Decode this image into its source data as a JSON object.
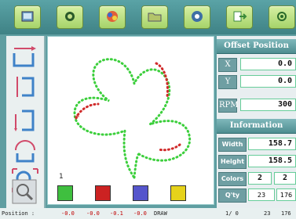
{
  "toolbar": {
    "buttons": [
      {
        "name": "open-icon"
      },
      {
        "name": "pattern-icon"
      },
      {
        "name": "color-icon"
      },
      {
        "name": "folder-icon"
      },
      {
        "name": "machine-icon"
      },
      {
        "name": "exit-icon"
      },
      {
        "name": "settings-icon"
      }
    ]
  },
  "tools": [
    "arrow-right-icon",
    "align-left-icon",
    "align-bottom-icon",
    "rotate-icon",
    "zoom-fit-icon",
    "zoom-icon"
  ],
  "canvas": {
    "index_label": "1",
    "swatches": [
      "#3fbf3f",
      "#cc2222",
      "#5555cc",
      "#e6d21a"
    ]
  },
  "offset": {
    "title": "Offset Position",
    "x_label": "X",
    "x_value": "0.0",
    "y_label": "Y",
    "y_value": "0.0",
    "rpm_label": "RPM",
    "rpm_value": "300"
  },
  "info": {
    "title": "Information",
    "width_label": "Width",
    "width_value": "158.7",
    "height_label": "Height",
    "height_value": "158.5",
    "colors_label": "Colors",
    "colors_a": "2",
    "colors_b": "2",
    "qty_label": "Q'ty",
    "qty_a": "23",
    "qty_b": "176"
  },
  "status": {
    "label": "Position :",
    "v1": "-0.0",
    "v2": "-0.0",
    "v3": "-0.1",
    "v4": "-0.0",
    "mode": "DRAW",
    "page": "1/ 0",
    "count": "23",
    "total": "176"
  }
}
